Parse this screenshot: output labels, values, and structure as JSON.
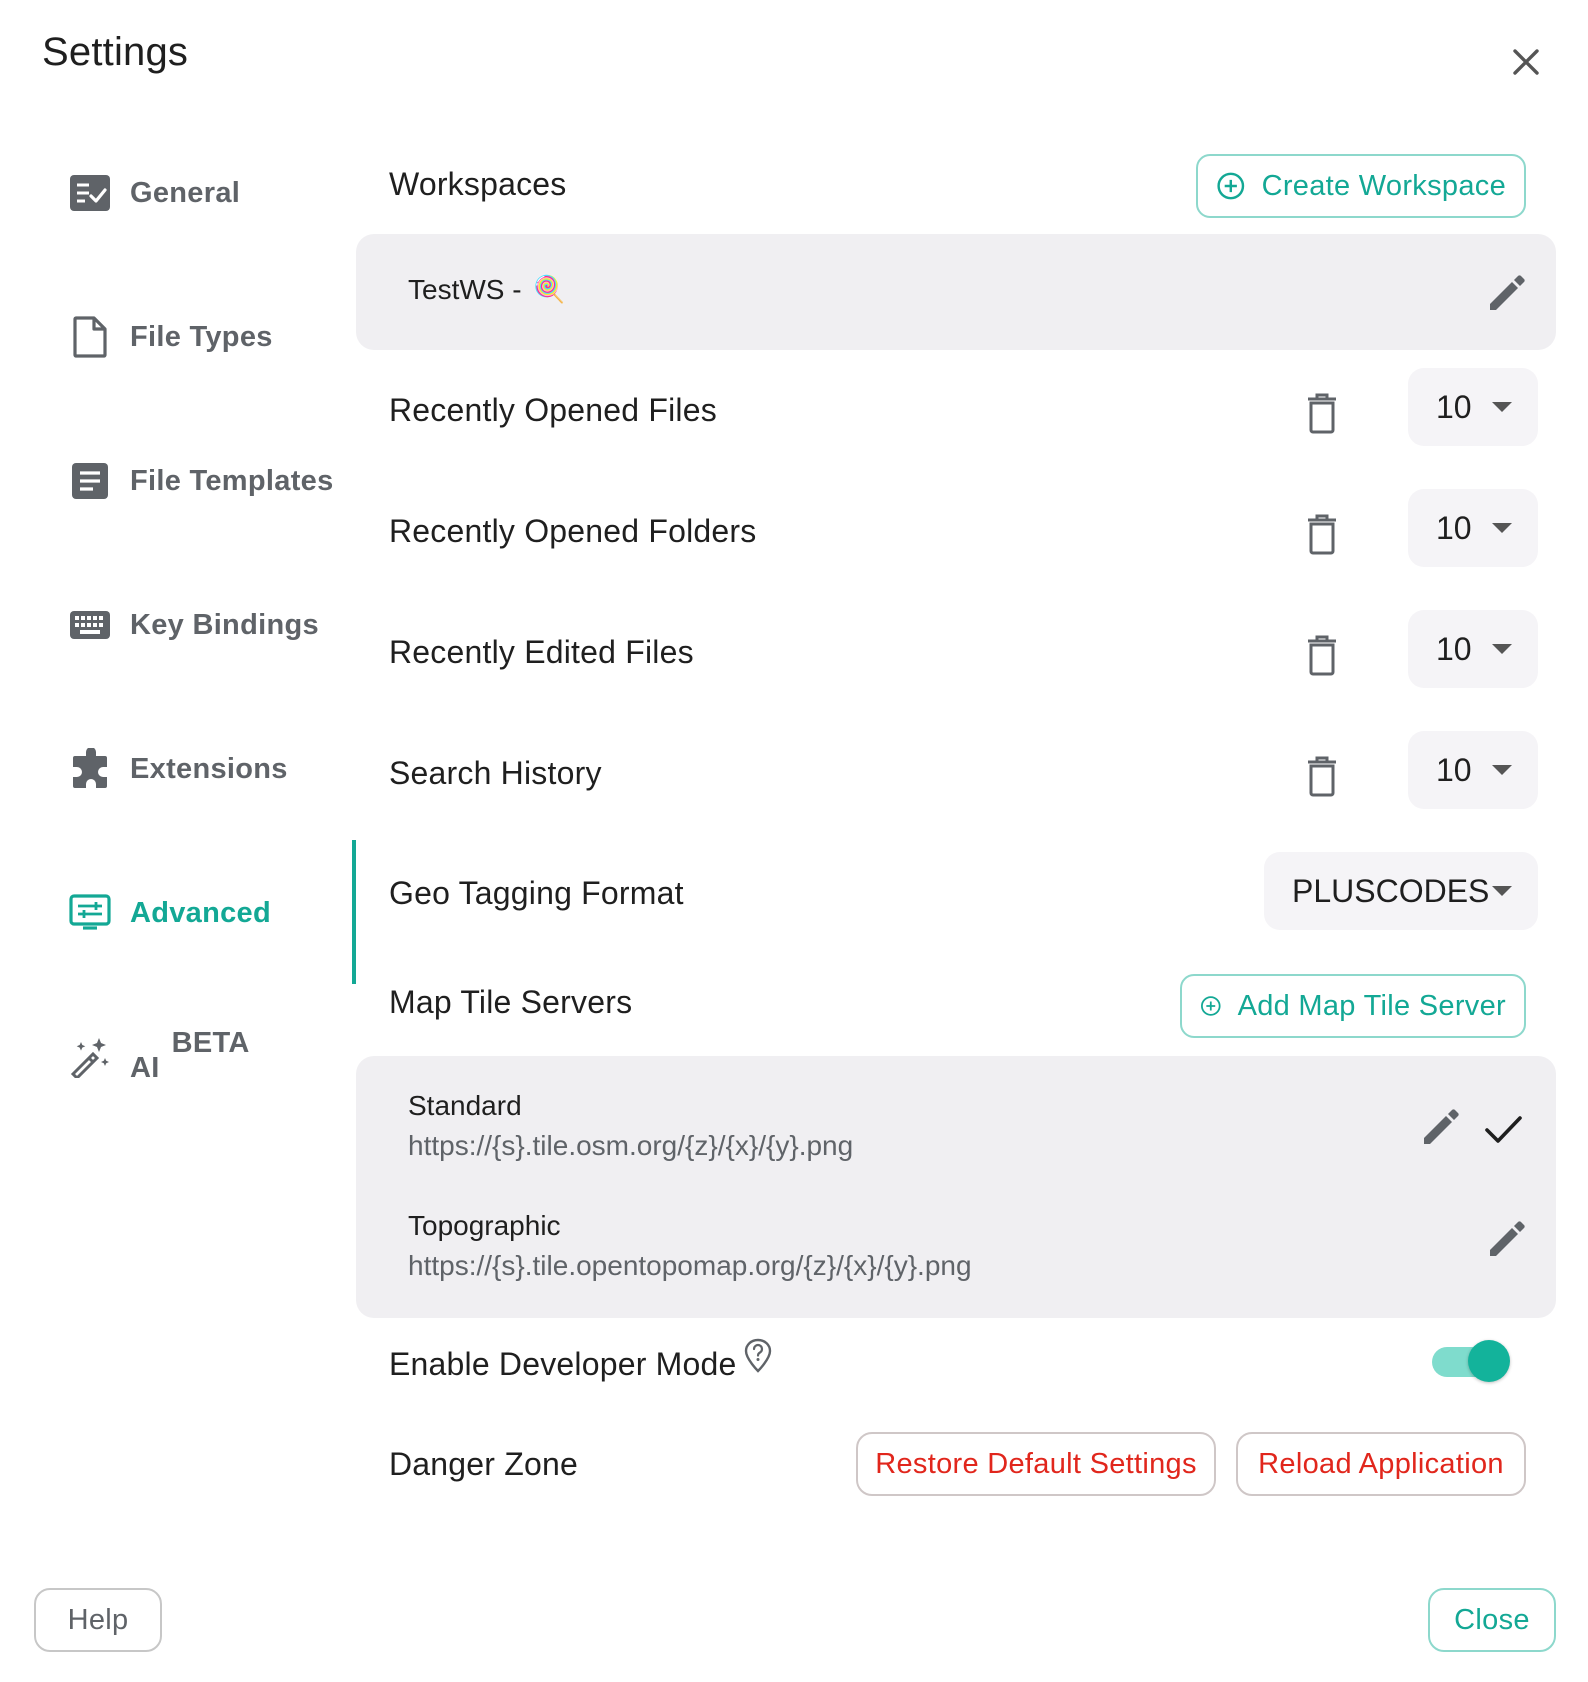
{
  "dialog": {
    "title": "Settings"
  },
  "sidebar": {
    "items": [
      {
        "label": "General",
        "icon": "general-check-list-icon"
      },
      {
        "label": "File Types",
        "icon": "file-icon"
      },
      {
        "label": "File Templates",
        "icon": "file-template-icon"
      },
      {
        "label": "Key Bindings",
        "icon": "keyboard-icon"
      },
      {
        "label": "Extensions",
        "icon": "puzzle-icon"
      },
      {
        "label": "Advanced",
        "icon": "advanced-settings-icon",
        "active": true
      },
      {
        "label": "AI",
        "badge": "BETA",
        "icon": "magic-wand-icon"
      }
    ]
  },
  "workspaces": {
    "label": "Workspaces",
    "create_button": "Create Workspace",
    "items": [
      {
        "name": "TestWS - ",
        "emoji": "🍭"
      }
    ]
  },
  "history_settings": [
    {
      "label": "Recently Opened Files",
      "value": "10"
    },
    {
      "label": "Recently Opened Folders",
      "value": "10"
    },
    {
      "label": "Recently Edited Files",
      "value": "10"
    },
    {
      "label": "Search History",
      "value": "10"
    }
  ],
  "geo_tagging": {
    "label": "Geo Tagging Format",
    "value": "PLUSCODES"
  },
  "map_tile_servers": {
    "label": "Map Tile Servers",
    "add_button": "Add Map Tile Server",
    "items": [
      {
        "name": "Standard",
        "url": "https://{s}.tile.osm.org/{z}/{x}/{y}.png",
        "selected": true
      },
      {
        "name": "Topographic",
        "url": "https://{s}.tile.opentopomap.org/{z}/{x}/{y}.png",
        "selected": false
      }
    ]
  },
  "developer_mode": {
    "label": "Enable Developer Mode",
    "enabled": true
  },
  "danger_zone": {
    "label": "Danger Zone",
    "restore_button": "Restore Default Settings",
    "reload_button": "Reload Application"
  },
  "footer": {
    "help_button": "Help",
    "close_button": "Close"
  },
  "colors": {
    "accent": "#13a895",
    "danger": "#e1261c",
    "panel_bg": "#f0eff2"
  }
}
